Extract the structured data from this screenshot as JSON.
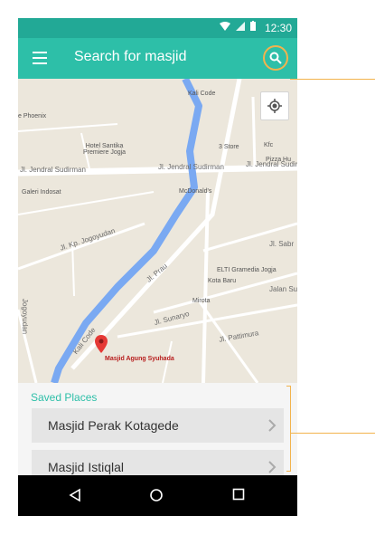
{
  "status_bar": {
    "time": "12:30"
  },
  "app_bar": {
    "title": "Search for masjid"
  },
  "map": {
    "labels": {
      "kali_code_top": "Kali Code",
      "phoenix": "e Phoenix",
      "hotel": "Hotel Santika\nPremiere Jogja",
      "store": "3 Store",
      "kfc": "Kfc",
      "pizza": "Pizza Hu",
      "galeri": "Galeri Indosat",
      "mcd": "McDonald's",
      "elti": "ELTI Gramedia Jogja",
      "kota_baru": "Kota Baru",
      "mirota": "Mirota",
      "masjid": "Masjid Agung Syuhada"
    },
    "roads": {
      "sudirman_left": "Jl. Jendral Sudirman",
      "sudirman_mid": "Jl. Jendral Sudirman",
      "sudirman_right": "Jl. Jendral Sudirman",
      "jogoyudan": "Jl. Kp. Jogoyudan",
      "sabr": "Jl. Sabr",
      "prau": "Jl. Prau",
      "jalan_su": "Jalan Su",
      "sunaryo": "Jl. Sunaryo",
      "pattimura": "Jl. Pattimura",
      "kali_code": "Kali Code",
      "jogoyudan_v": "Jogoyudan"
    }
  },
  "saved_places": {
    "title": "Saved Places",
    "items": [
      "Masjid Perak Kotagede",
      "Masjid Istiqlal"
    ]
  },
  "colors": {
    "status_bar": "#22a996",
    "app_bar": "#2dbfa8",
    "callout": "#f2b34d",
    "river": "#7aa9f2"
  }
}
